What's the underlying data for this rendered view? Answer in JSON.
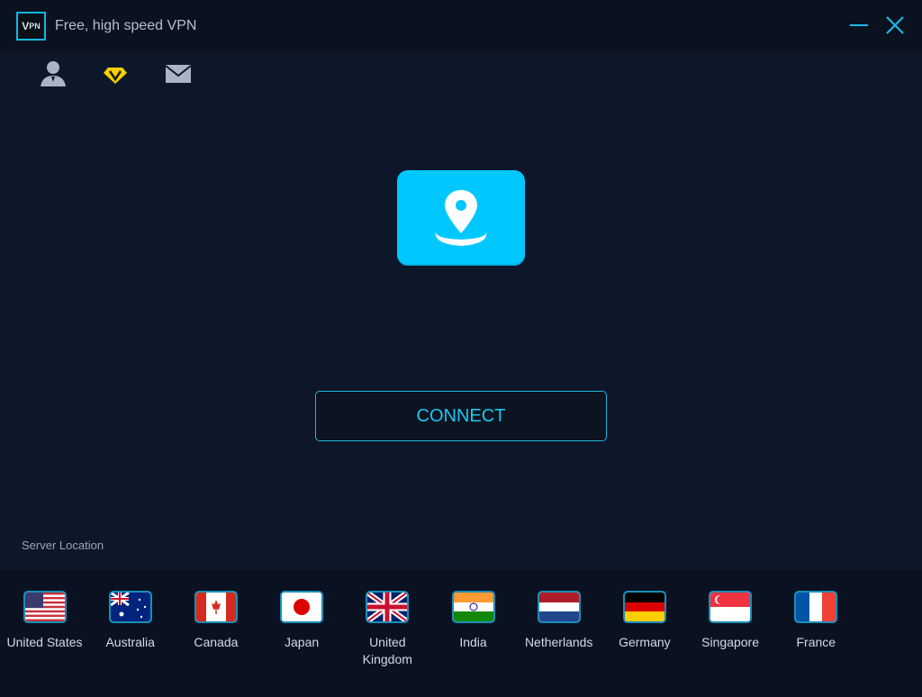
{
  "app": {
    "logo_text": "VPN",
    "title": "Free, high speed VPN"
  },
  "toolbar": [
    {
      "icon": "user-icon"
    },
    {
      "icon": "premium-diamond-icon",
      "color": "#f5d000"
    },
    {
      "icon": "mail-icon"
    }
  ],
  "main": {
    "connect_label": "CONNECT",
    "server_location_label": "Server Location",
    "accent": "#00c8ff"
  },
  "countries": [
    {
      "name": "United States",
      "flag": "us"
    },
    {
      "name": "Australia",
      "flag": "au"
    },
    {
      "name": "Canada",
      "flag": "ca"
    },
    {
      "name": "Japan",
      "flag": "jp"
    },
    {
      "name": "United Kingdom",
      "flag": "gb"
    },
    {
      "name": "India",
      "flag": "in"
    },
    {
      "name": "Netherlands",
      "flag": "nl"
    },
    {
      "name": "Germany",
      "flag": "de"
    },
    {
      "name": "Singapore",
      "flag": "sg"
    },
    {
      "name": "France",
      "flag": "fr"
    }
  ]
}
